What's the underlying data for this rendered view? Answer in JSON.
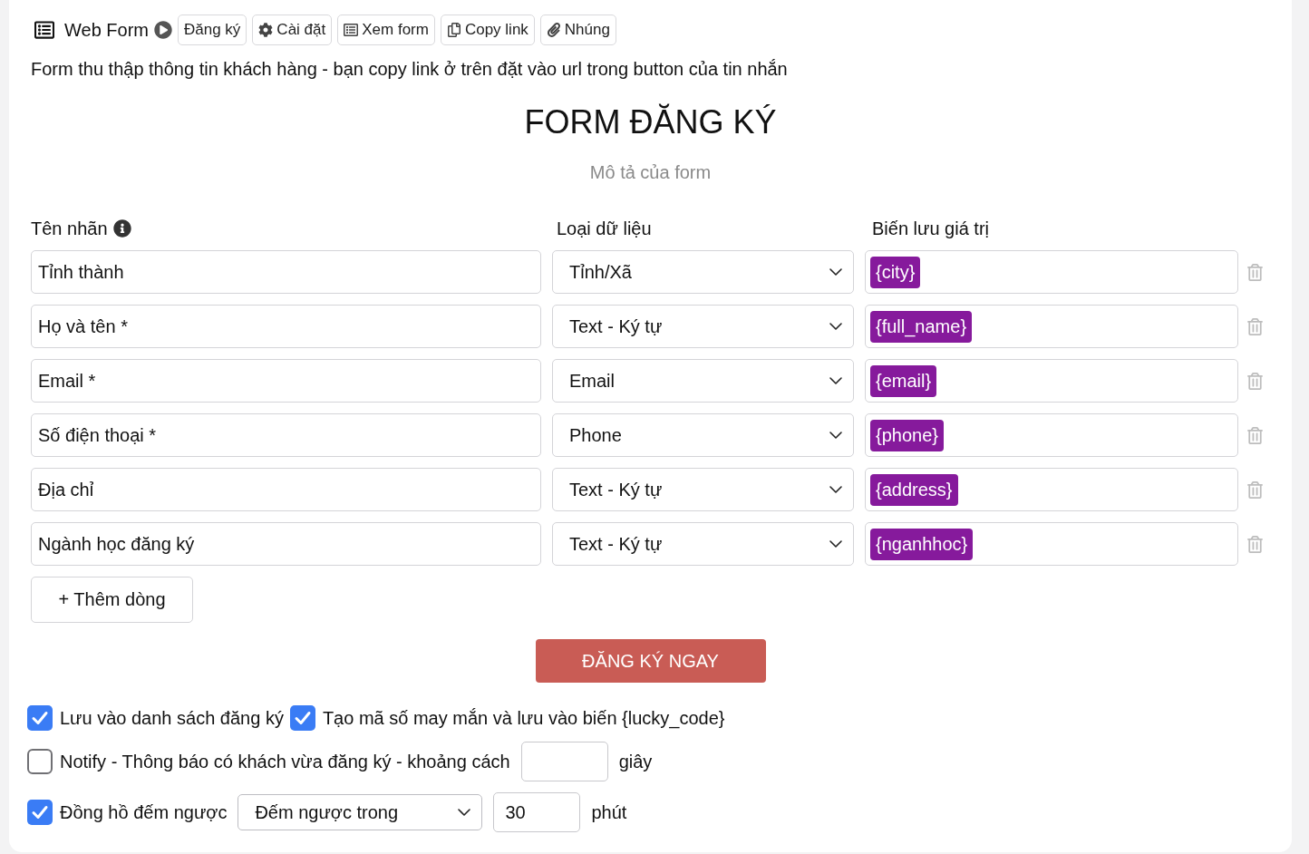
{
  "header": {
    "title": "Web Form",
    "buttons": [
      "Đăng ký",
      "Cài đặt",
      "Xem form",
      "Copy link",
      "Nhúng"
    ]
  },
  "description": "Form thu thập thông tin khách hàng - bạn copy link ở trên đặt vào url trong button của tin nhắn",
  "form": {
    "title": "FORM ĐĂNG KÝ",
    "subtitle": "Mô tả của form"
  },
  "columns": [
    "Tên nhãn",
    "Loại dữ liệu",
    "Biến lưu giá trị"
  ],
  "rows": [
    {
      "label": "Tỉnh thành",
      "type": "Tỉnh/Xã",
      "variable": "{city}"
    },
    {
      "label": "Họ và tên *",
      "type": "Text - Ký tự",
      "variable": "{full_name}"
    },
    {
      "label": "Email *",
      "type": "Email",
      "variable": "{email}"
    },
    {
      "label": "Số điện thoại *",
      "type": "Phone",
      "variable": "{phone}"
    },
    {
      "label": "Địa chỉ",
      "type": "Text - Ký tự",
      "variable": "{address}"
    },
    {
      "label": "Ngành học đăng ký",
      "type": "Text - Ký tự",
      "variable": "{nganhhoc}"
    }
  ],
  "add_row_button": "+ Thêm dòng",
  "submit_button": "ĐĂNG KÝ NGAY",
  "options": [
    {
      "items": [
        {
          "kind": "checkbox",
          "label": "Lưu vào danh sách đăng ký",
          "checked": true
        },
        {
          "kind": "checkbox",
          "label": "Tạo mã số may mắn và lưu vào biến {lucky_code}",
          "checked": true
        }
      ]
    },
    {
      "items": [
        {
          "kind": "checkbox",
          "label": "Notify - Thông báo có khách vừa đăng ký - khoảng cách",
          "checked": false
        },
        {
          "kind": "input"
        },
        {
          "kind": "text",
          "label": "giây"
        }
      ]
    },
    {
      "items": [
        {
          "kind": "checkbox",
          "label": "Đồng hồ đếm ngược",
          "checked": true
        },
        {
          "kind": "select",
          "value": "Đếm ngược trong"
        },
        {
          "kind": "input",
          "value": "30"
        },
        {
          "kind": "text",
          "label": "phút"
        }
      ]
    }
  ]
}
